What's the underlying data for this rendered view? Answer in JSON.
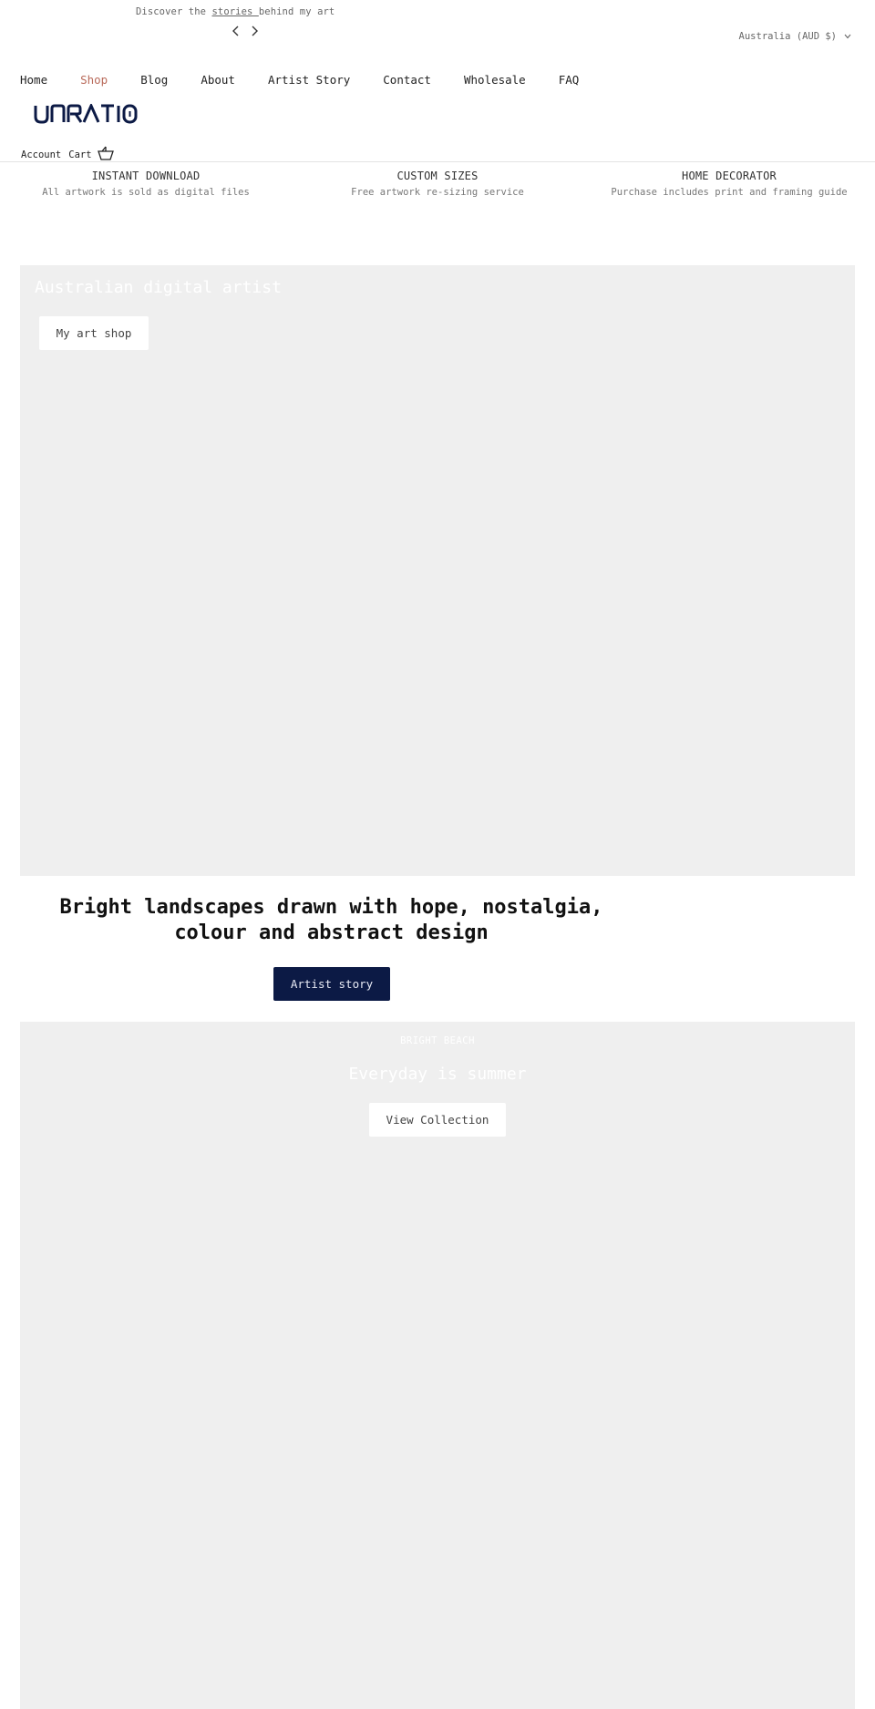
{
  "announcement": {
    "prefix": "Discover the ",
    "link": "stories ",
    "suffix": "behind my art",
    "prev_icon": "chevron-left-icon",
    "next_icon": "chevron-right-icon"
  },
  "locale": {
    "label": "Australia (AUD $)",
    "icon": "chevron-down-icon"
  },
  "nav": {
    "items": [
      {
        "label": "Home",
        "active": false
      },
      {
        "label": "Shop",
        "active": true
      },
      {
        "label": "Blog",
        "active": false
      },
      {
        "label": "About",
        "active": false
      },
      {
        "label": "Artist Story",
        "active": false
      },
      {
        "label": "Contact",
        "active": false
      },
      {
        "label": "Wholesale",
        "active": false
      },
      {
        "label": "FAQ",
        "active": false
      }
    ]
  },
  "brand": {
    "logo_text": "UNRATIO",
    "color": "#0c1a45"
  },
  "account": {
    "account_label": "Account",
    "cart_label": "Cart",
    "cart_icon": "basket-icon"
  },
  "usps": [
    {
      "title": "INSTANT DOWNLOAD",
      "subtitle": "All artwork is sold as digital files"
    },
    {
      "title": "CUSTOM SIZES",
      "subtitle": "Free artwork re-sizing service"
    },
    {
      "title": "HOME DECORATOR",
      "subtitle": "Purchase includes print and framing guide"
    }
  ],
  "hero": {
    "title": "Australian digital artist",
    "button_label": "My art shop"
  },
  "statement": {
    "text_line1": "Bright landscapes drawn with hope, nostalgia,",
    "text_line2": "colour and abstract design",
    "button_label": "Artist story",
    "button_color": "#0c1a45"
  },
  "collection": {
    "kicker": "BRIGHT BEACH",
    "title": "Everyday is summer",
    "button_label": "View Collection"
  },
  "colors": {
    "accent_active_nav": "#b96a5a",
    "placeholder_bg": "#efefef"
  }
}
